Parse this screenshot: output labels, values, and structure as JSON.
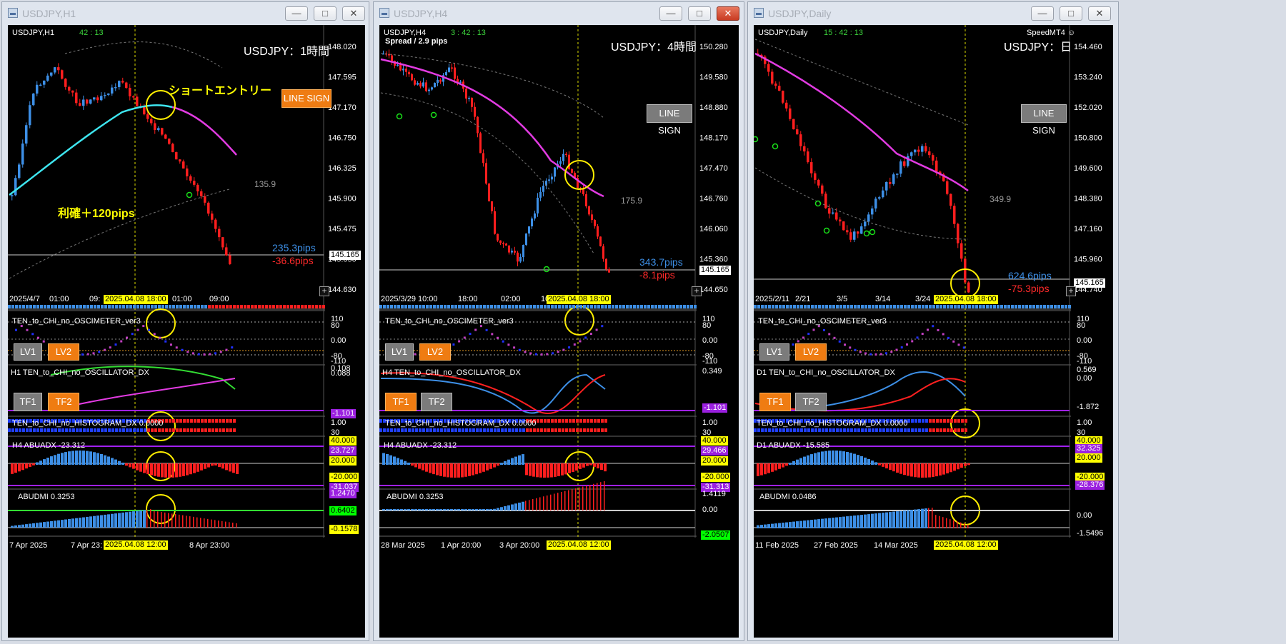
{
  "windows": [
    {
      "title": "USDJPY,H1",
      "symbol_label": "USDJPY,H1",
      "timer": "42 : 13",
      "chart_title": "USDJPY：1時間",
      "spread": "",
      "broker": "",
      "line_sign": "LINE SIGN",
      "prices": [
        "148.020",
        "147.595",
        "147.170",
        "146.750",
        "146.325",
        "145.900",
        "145.475",
        "145.050",
        "144.630"
      ],
      "current_price": "145.165",
      "pips_pos": "235.3pips",
      "pips_neg": "-36.6pips",
      "hidden_label": "135.9",
      "time_labels": [
        "2025/4/7",
        "01:00",
        "09:",
        "01:00",
        "09:00"
      ],
      "time_highlight": "2025.04.08 18:00",
      "annotation_entry": "ショートエントリー",
      "annotation_profit": "利確＋120pips",
      "osc_title": "TEN_to_CHI_no_OSCIMETER_ver3",
      "osc_scale": [
        "110",
        "80",
        "0.00",
        "-80",
        "-110"
      ],
      "lv1": "LV1",
      "lv2": "LV2",
      "oscillator_title": "H1 TEN_to_CHI_no_OSCILLATOR_DX",
      "oscillator_scale": [
        "0.108",
        "0.088"
      ],
      "oscillator_value": "-1.101",
      "tf1": "TF1",
      "tf2": "TF2",
      "histogram_title": "TEN_to_CHI_no_HISTOGRAM_DX 0.0000",
      "hist_scale": [
        "1.00",
        "30"
      ],
      "abuadx_title": "H4 ABUADX -23.312",
      "abuadx_labels": [
        "40.000",
        "23.727",
        "20.000",
        "-20.000",
        "-31.037"
      ],
      "abudmi_title": "ABUDMI  0.3253",
      "abudmi_labels": [
        "1.2470",
        "0.6402",
        "-0.1578"
      ],
      "bottom_times": [
        "7 Apr 2025",
        "7 Apr 23:",
        "8 Apr 23:00"
      ],
      "bottom_highlight": "2025.04.08 12:00"
    },
    {
      "title": "USDJPY,H4",
      "symbol_label": "USDJPY,H4",
      "timer": "3 : 42 : 13",
      "chart_title": "USDJPY：4時間",
      "spread": "Spread / 2.9 pips",
      "broker": "",
      "line_sign": "LINE SIGN",
      "prices": [
        "150.280",
        "149.580",
        "148.880",
        "148.170",
        "147.470",
        "146.760",
        "146.060",
        "145.360",
        "144.650"
      ],
      "current_price": "145.165",
      "pips_pos": "343.7pips",
      "pips_neg": "-8.1pips",
      "hidden_label": "175.9",
      "time_labels": [
        "2025/3/29 10:00",
        "18:00",
        "02:00",
        "10"
      ],
      "time_highlight": "2025.04.08 18:00",
      "annotation_entry": "",
      "annotation_profit": "",
      "osc_title": "TEN_to_CHI_no_OSCIMETER_ver3",
      "osc_scale": [
        "110",
        "80",
        "0.00",
        "-80",
        "-110"
      ],
      "lv1": "LV1",
      "lv2": "LV2",
      "oscillator_title": "H4 TEN_to_CHI_no_OSCILLATOR_DX",
      "oscillator_scale": [
        "0.349"
      ],
      "oscillator_value": "-1.101",
      "tf1": "TF1",
      "tf2": "TF2",
      "histogram_title": "TEN_to_CHI_no_HISTOGRAM_DX 0.0000",
      "hist_scale": [
        "1.00",
        "30"
      ],
      "abuadx_title": "H4 ABUADX -23.312",
      "abuadx_labels": [
        "40.000",
        "29.466",
        "20.000",
        "-20.000",
        "-31.313"
      ],
      "abudmi_title": "ABUDMI  0.3253",
      "abudmi_labels": [
        "1.4119",
        "0.00",
        "-2.0507"
      ],
      "bottom_times": [
        "28 Mar 2025",
        "1 Apr 20:00",
        "3 Apr 20:00"
      ],
      "bottom_highlight": "2025.04.08 12:00"
    },
    {
      "title": "USDJPY,Daily",
      "symbol_label": "USDJPY,Daily",
      "timer": "15 : 42 : 13",
      "chart_title": "USDJPY：日",
      "spread": "",
      "broker": "SpeedMT4 ☺",
      "line_sign": "LINE SIGN",
      "prices": [
        "154.460",
        "153.240",
        "152.020",
        "150.800",
        "149.600",
        "148.380",
        "147.160",
        "145.960",
        "144.740"
      ],
      "current_price": "145.165",
      "pips_pos": "624.6pips",
      "pips_neg": "-75.3pips",
      "hidden_label": "349.9",
      "time_labels": [
        "2025/2/11",
        "2/21",
        "3/5",
        "3/14",
        "3/24"
      ],
      "time_highlight": "2025.04.08 18:00",
      "annotation_entry": "",
      "annotation_profit": "",
      "osc_title": "TEN_to_CHI_no_OSCIMETER_ver3",
      "osc_scale": [
        "110",
        "80",
        "0.00",
        "-80",
        "-110"
      ],
      "lv1": "LV1",
      "lv2": "LV2",
      "oscillator_title": "D1 TEN_to_CHI_no_OSCILLATOR_DX",
      "oscillator_scale": [
        "0.569",
        "0.00",
        "-1.872"
      ],
      "oscillator_value": "",
      "tf1": "TF1",
      "tf2": "TF2",
      "histogram_title": "TEN_to_CHI_no_HISTOGRAM_DX 0.0000",
      "hist_scale": [
        "1.00",
        "30"
      ],
      "abuadx_title": "D1 ABUADX -15.585",
      "abuadx_labels": [
        "40.000",
        "32.325",
        "20.000",
        "-20.000",
        "-28.376"
      ],
      "abudmi_title": "ABUDMI  0.0486",
      "abudmi_labels": [
        "0.00",
        "-1.5496"
      ],
      "bottom_times": [
        "11 Feb 2025",
        "27 Feb 2025",
        "14 Mar 2025"
      ],
      "bottom_highlight": "2025.04.08 12:00"
    }
  ],
  "controls": {
    "minimize": "—",
    "maximize": "□",
    "close": "✕"
  }
}
